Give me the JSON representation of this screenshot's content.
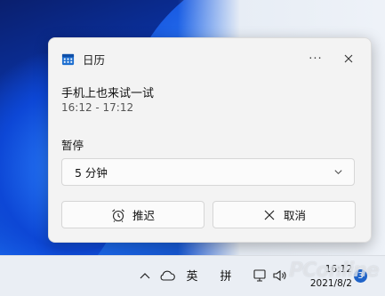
{
  "notification": {
    "app_name": "日历",
    "more_label": "···",
    "event_title": "手机上也来试一试",
    "event_time": "16:12 - 17:12",
    "snooze_label": "暂停",
    "snooze_selected": "5 分钟",
    "snooze_button": "推迟",
    "dismiss_button": "取消"
  },
  "taskbar": {
    "ime_english": "英",
    "ime_pinyin": "拼",
    "time": "16:12",
    "date": "2021/8/2",
    "notification_count": "3"
  },
  "watermark": "PConline",
  "colors": {
    "card_background": "#f3f3f3",
    "taskbar_background": "#eaeef4",
    "badge": "#1f63c8",
    "calendar_icon": "#1e6fd0"
  },
  "icons": {
    "app": "calendar-icon",
    "more": "more-icon",
    "close": "close-icon",
    "dropdown": "chevron-down-icon",
    "snooze": "alarm-clock-icon",
    "dismiss": "x-icon",
    "tray_expand": "chevron-up-icon",
    "onedrive": "cloud-icon",
    "network": "network-icon",
    "volume": "volume-icon"
  }
}
